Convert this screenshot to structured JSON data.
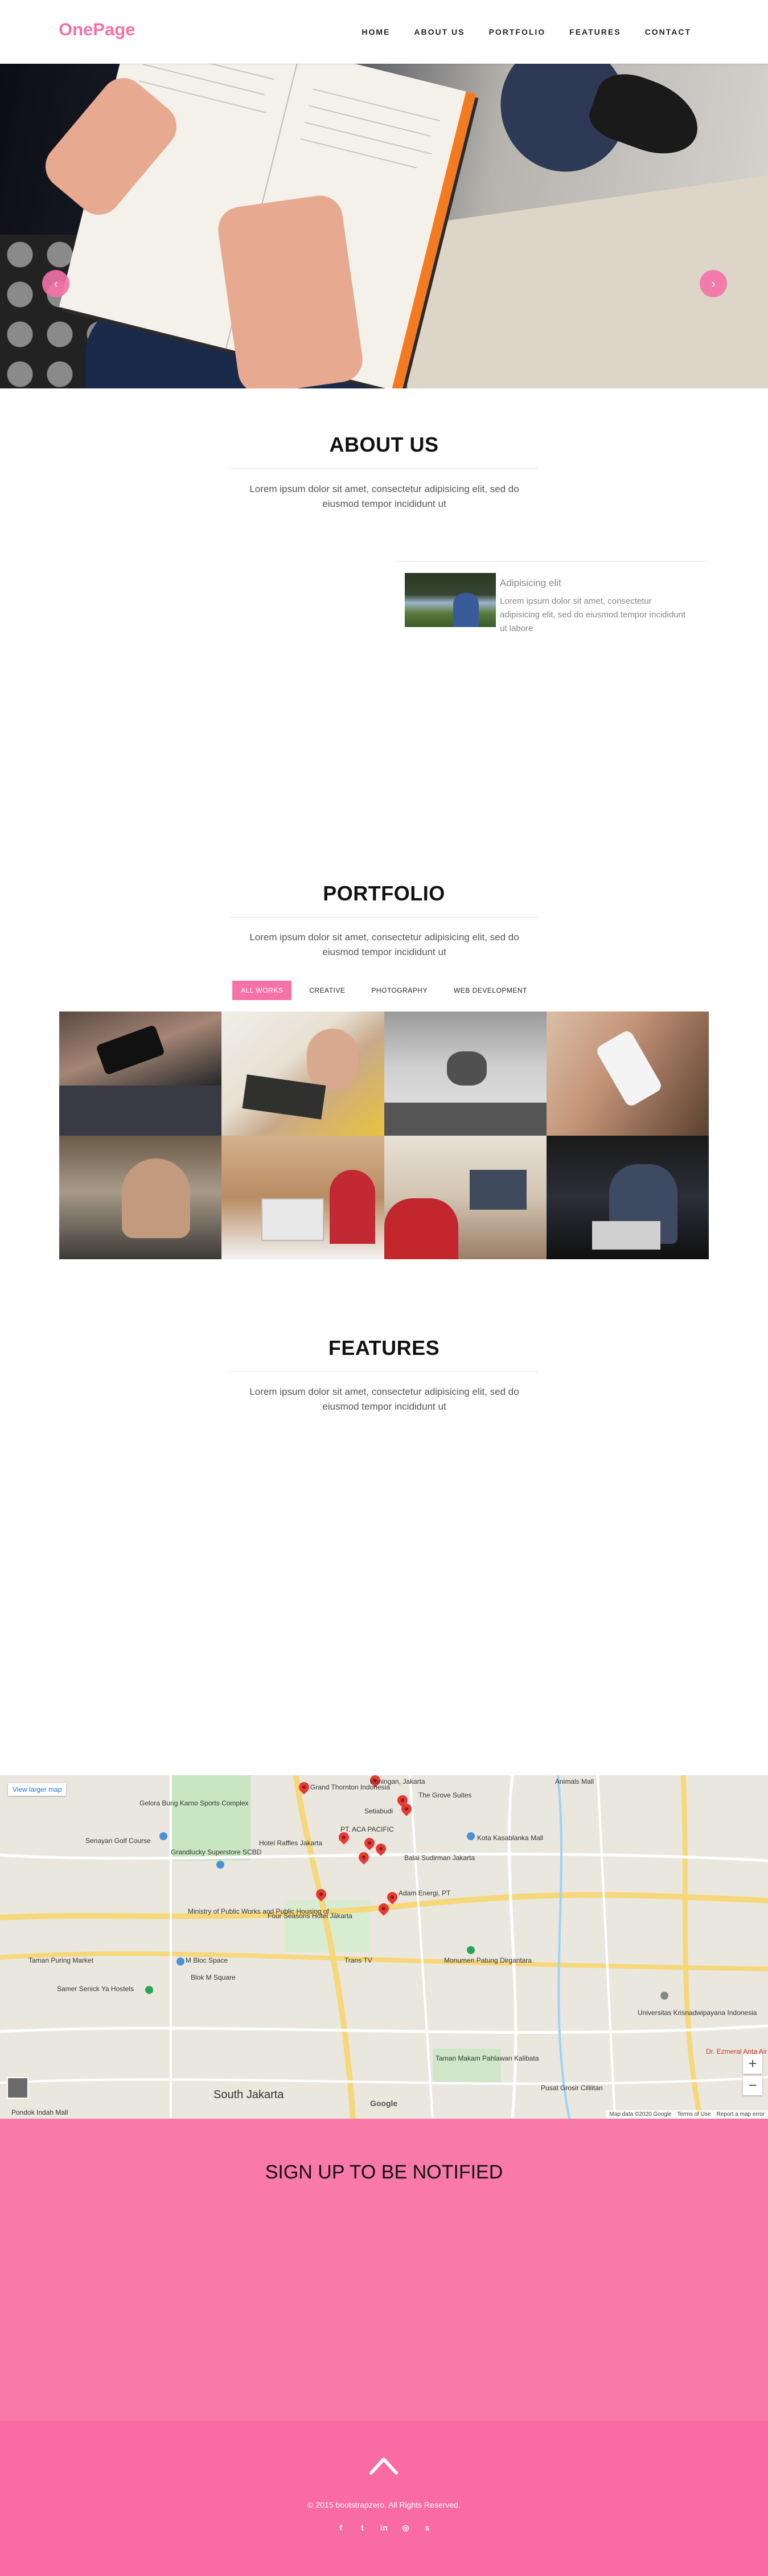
{
  "nav": {
    "logo": "OnePage",
    "items": [
      {
        "label": "HOME"
      },
      {
        "label": "ABOUT US"
      },
      {
        "label": "PORTFOLIO"
      },
      {
        "label": "FEATURES"
      },
      {
        "label": "CONTACT"
      }
    ]
  },
  "hero": {
    "prev_glyph": "‹",
    "next_glyph": "›"
  },
  "about": {
    "title": "ABOUT US",
    "subtitle": "Lorem ipsum dolor sit amet, consectetur adipisicing elit, sed do eiusmod tempor incididunt ut",
    "card": {
      "heading": "Adipisicing elit",
      "text": "Lorem ipsum dolor sit amet, consectetur adipisicing elit, sed do eiusmod tempor incididunt ut labore"
    }
  },
  "portfolio": {
    "title": "PORTFOLIO",
    "subtitle": "Lorem ipsum dolor sit amet, consectetur adipisicing elit, sed do eiusmod tempor incididunt ut",
    "filters": [
      {
        "label": "ALL WORKS",
        "active": true
      },
      {
        "label": "CREATIVE",
        "active": false
      },
      {
        "label": "PHOTOGRAPHY",
        "active": false
      },
      {
        "label": "WEB DEVELOPMENT",
        "active": false
      }
    ]
  },
  "features": {
    "title": "FEATURES",
    "subtitle": "Lorem ipsum dolor sit amet, consectetur adipisicing elit, sed do eiusmod tempor incididunt ut"
  },
  "map": {
    "view_larger": "View larger map",
    "zoom_in": "+",
    "zoom_out": "−",
    "google": "Google",
    "attribution": "Map data ©2020 Google",
    "terms": "Terms of Use",
    "report": "Report a map error",
    "labels": [
      "Kuningan, Jakarta",
      "Grand Thornton Indonesia",
      "The Grove Suites",
      "Setiabudi",
      "Gelora Bung Karno Sports Complex",
      "Senayan Golf Course",
      "Hotel Raffles Jakarta",
      "PT. ACA PACIFIC",
      "Kota Kasablanka Mall",
      "Balai Sudirman Jakarta",
      "Grandlucky Superstore SCBD",
      "Ministry of Public Works and Public Housing of ...",
      "Four Seasons Hotel Jakarta",
      "Adam Energi, PT",
      "M Bloc Space",
      "Taman Puring Market",
      "Blok M Square",
      "Trans TV",
      "Monumen Patung Dirgantara",
      "Samer Senick Ya Hostels",
      "Taman Makam Pahlawan Kalibata",
      "South Jakarta",
      "Universitas Krisnadwipayana Indonesia",
      "Dr. Ezmeral Anta Air Freshener",
      "Pusat Grosir Cililitan",
      "Animals Mall",
      "Pondok Indah Mall"
    ]
  },
  "signup": {
    "title": "SIGN UP TO BE NOTIFIED"
  },
  "footer": {
    "copyright": "© 2015 bootstrapzero. All Rights Reserved.",
    "socials": [
      {
        "icon": "facebook-icon",
        "glyph": "f"
      },
      {
        "icon": "twitter-icon",
        "glyph": "t"
      },
      {
        "icon": "linkedin-icon",
        "glyph": "in"
      },
      {
        "icon": "dribbble-icon",
        "glyph": "◎"
      },
      {
        "icon": "skype-icon",
        "glyph": "s"
      }
    ]
  },
  "colors": {
    "accent": "#f472a8",
    "signup_bg": "#f97aa9",
    "footer_bg": "#f86ba3"
  }
}
